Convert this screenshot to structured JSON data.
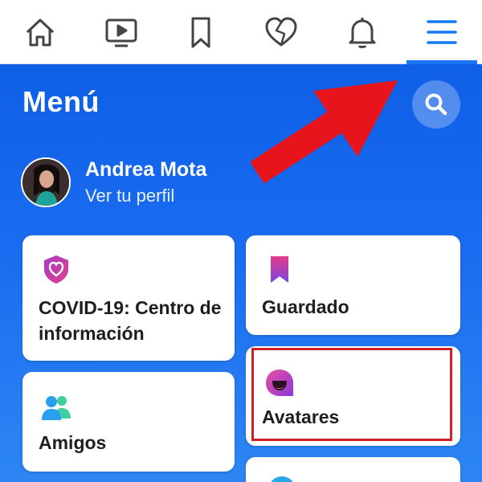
{
  "nav": {
    "icons": [
      "home-icon",
      "watch-icon",
      "bookmark-icon",
      "dating-heart-icon",
      "bell-icon",
      "hamburger-menu-icon"
    ],
    "active": "hamburger-menu-icon"
  },
  "menu": {
    "title": "Menú",
    "search_icon": "search-icon"
  },
  "profile": {
    "name": "Andrea Mota",
    "subtitle": "Ver tu perfil"
  },
  "shortcuts": {
    "covid": {
      "label": "COVID-19: Centro de información",
      "icon": "covid-shield-heart-icon"
    },
    "guardado": {
      "label": "Guardado",
      "icon": "saved-bookmark-icon"
    },
    "avatares": {
      "label": "Avatares",
      "icon": "avatar-smile-icon"
    },
    "amigos": {
      "label": "Amigos",
      "icon": "friends-icon"
    }
  },
  "colors": {
    "brand_blue": "#1877f2",
    "annotation_red": "#e8141b"
  }
}
